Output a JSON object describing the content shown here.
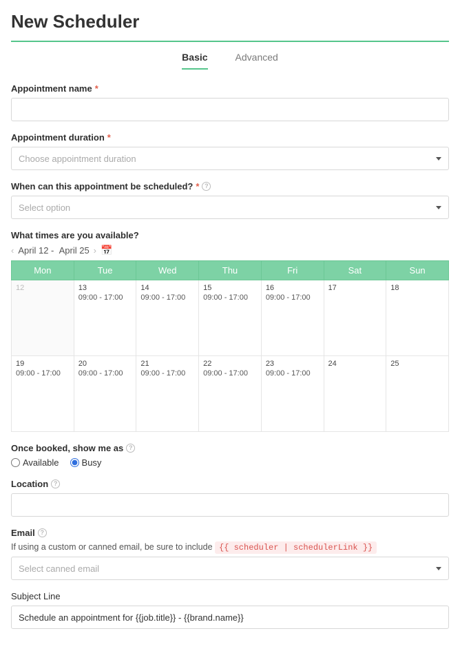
{
  "title": "New Scheduler",
  "tabs": {
    "basic": "Basic",
    "advanced": "Advanced"
  },
  "fields": {
    "name_label": "Appointment name",
    "duration_label": "Appointment duration",
    "duration_placeholder": "Choose appointment duration",
    "when_label": "When can this appointment be scheduled?",
    "when_placeholder": "Select option",
    "avail_label": "What times are you available?",
    "date_start": "April 12",
    "date_end": "April 25",
    "booked_label": "Once booked, show me as",
    "radio_available": "Available",
    "radio_busy": "Busy",
    "location_label": "Location",
    "email_label": "Email",
    "email_hint": "If using a custom or canned email, be sure to include ",
    "email_mergetag": "{{ scheduler | schedulerLink }}",
    "email_placeholder": "Select canned email",
    "subject_label": "Subject Line",
    "subject_value": "Schedule an appointment for {{job.title}} - {{brand.name}}"
  },
  "calendar": {
    "headers": [
      "Mon",
      "Tue",
      "Wed",
      "Thu",
      "Fri",
      "Sat",
      "Sun"
    ],
    "rows": [
      [
        {
          "num": "12",
          "hours": "",
          "dim": true
        },
        {
          "num": "13",
          "hours": "09:00 - 17:00"
        },
        {
          "num": "14",
          "hours": "09:00 - 17:00"
        },
        {
          "num": "15",
          "hours": "09:00 - 17:00"
        },
        {
          "num": "16",
          "hours": "09:00 - 17:00"
        },
        {
          "num": "17",
          "hours": ""
        },
        {
          "num": "18",
          "hours": ""
        }
      ],
      [
        {
          "num": "19",
          "hours": "09:00 - 17:00"
        },
        {
          "num": "20",
          "hours": "09:00 - 17:00"
        },
        {
          "num": "21",
          "hours": "09:00 - 17:00"
        },
        {
          "num": "22",
          "hours": "09:00 - 17:00"
        },
        {
          "num": "23",
          "hours": "09:00 - 17:00"
        },
        {
          "num": "24",
          "hours": ""
        },
        {
          "num": "25",
          "hours": ""
        }
      ]
    ]
  }
}
